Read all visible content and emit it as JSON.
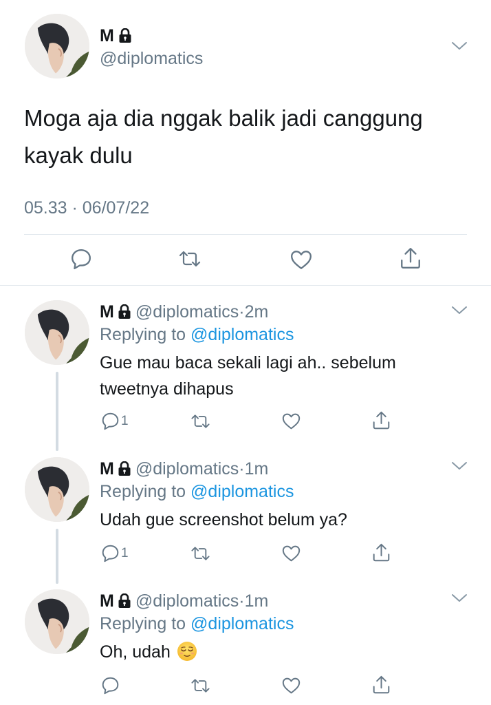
{
  "main_tweet": {
    "name": "M",
    "handle": "@diplomatics",
    "text": "Moga aja dia nggak balik jadi canggung kayak dulu",
    "timestamp": "05.33 · 06/07/22",
    "icons": [
      "lock-icon",
      "chevron-down-icon",
      "reply-icon",
      "retweet-icon",
      "like-icon",
      "share-icon"
    ]
  },
  "replies": [
    {
      "name": "M",
      "handle": "@diplomatics",
      "separator": "·",
      "time": "2m",
      "replying_label": "Replying to ",
      "replying_handle": "@diplomatics",
      "text": "Gue mau baca sekali lagi ah.. sebelum tweetnya dihapus",
      "reply_count": "1"
    },
    {
      "name": "M",
      "handle": "@diplomatics",
      "separator": "·",
      "time": "1m",
      "replying_label": "Replying to ",
      "replying_handle": "@diplomatics",
      "text": "Udah gue screenshot belum ya?",
      "reply_count": "1"
    },
    {
      "name": "M",
      "handle": "@diplomatics",
      "separator": "·",
      "time": "1m",
      "replying_label": "Replying to ",
      "replying_handle": "@diplomatics",
      "text": "Oh, udah",
      "text_emoji": "relieved-face-emoji",
      "reply_count": ""
    }
  ],
  "colors": {
    "text": "#14171a",
    "secondary": "#657786",
    "link": "#1b95e0",
    "divider": "#e1e8ed",
    "thread_line": "#d3dbe2"
  }
}
